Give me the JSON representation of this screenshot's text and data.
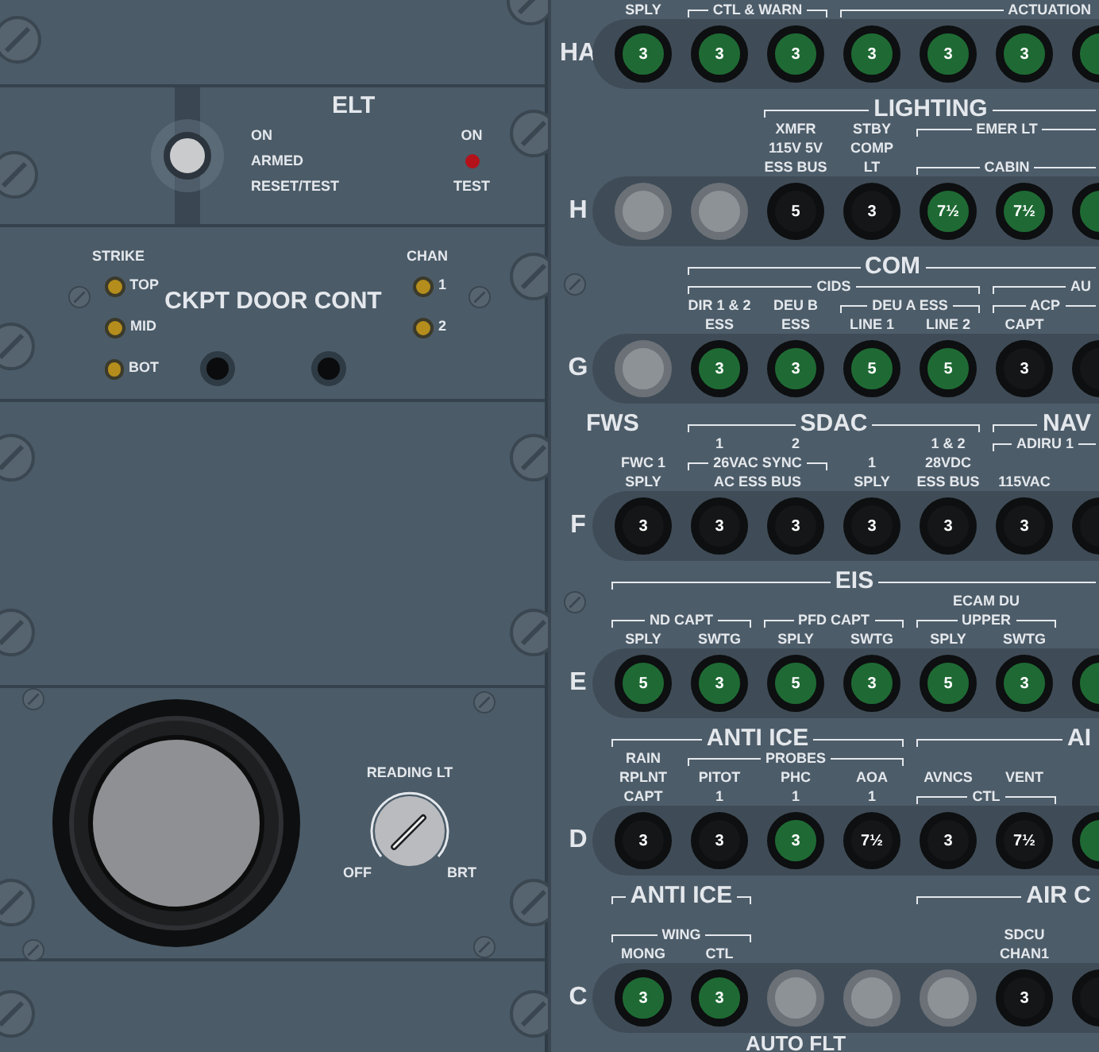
{
  "elt": {
    "title": "ELT",
    "positions": [
      {
        "label": "ON",
        "selected": false
      },
      {
        "label": "ARMED",
        "selected": true
      },
      {
        "label": "RESET/TEST",
        "selected": false
      }
    ],
    "indicator": {
      "top": "ON",
      "bottom": "TEST"
    }
  },
  "ckpt_door": {
    "title": "CKPT DOOR CONT",
    "strike_label": "STRIKE",
    "strike_lights": [
      "TOP",
      "MID",
      "BOT"
    ],
    "chan_label": "CHAN",
    "chan_lights": [
      "1",
      "2"
    ]
  },
  "reading_lt": {
    "title": "READING LT",
    "min": "OFF",
    "max": "BRT"
  },
  "rows": [
    {
      "label": "HA",
      "header": [
        {
          "kind": "label",
          "text": "SPLY"
        },
        {
          "kind": "group",
          "text": "CTL & WARN"
        },
        {
          "kind": "group",
          "text": "ACTUATION"
        }
      ],
      "breakers": [
        {
          "kind": "green",
          "value": "3"
        },
        {
          "kind": "green",
          "value": "3"
        },
        {
          "kind": "green",
          "value": "3"
        },
        {
          "kind": "green",
          "value": "3"
        },
        {
          "kind": "green",
          "value": "3"
        },
        {
          "kind": "green",
          "value": "3"
        },
        {
          "kind": "green"
        }
      ]
    },
    {
      "label": "H",
      "header": [
        {
          "kind": "title",
          "text": "LIGHTING"
        },
        {
          "kind": "label",
          "text": "XMFR\n115V 5V\nESS BUS"
        },
        {
          "kind": "label",
          "text": "STBY\nCOMP\nLT"
        },
        {
          "kind": "group",
          "text": "EMER LT"
        },
        {
          "kind": "group",
          "text": "CABIN"
        }
      ],
      "breakers": [
        {
          "kind": "blank"
        },
        {
          "kind": "blank"
        },
        {
          "kind": "black",
          "value": "5"
        },
        {
          "kind": "black",
          "value": "3"
        },
        {
          "kind": "green",
          "value": "7½"
        },
        {
          "kind": "green",
          "value": "7½"
        },
        {
          "kind": "green"
        }
      ]
    },
    {
      "label": "G",
      "header": [
        {
          "kind": "title",
          "text": "COM"
        },
        {
          "kind": "group",
          "text": "CIDS"
        },
        {
          "kind": "group",
          "text": "AU"
        },
        {
          "kind": "label",
          "text": "DIR 1 & 2\nESS"
        },
        {
          "kind": "label",
          "text": "DEU B\nESS"
        },
        {
          "kind": "group",
          "text": "DEU A ESS"
        },
        {
          "kind": "label",
          "text": "LINE 1"
        },
        {
          "kind": "label",
          "text": "LINE 2"
        },
        {
          "kind": "group",
          "text": "ACP"
        },
        {
          "kind": "label",
          "text": "CAPT"
        }
      ],
      "breakers": [
        {
          "kind": "blank"
        },
        {
          "kind": "green",
          "value": "3"
        },
        {
          "kind": "green",
          "value": "3"
        },
        {
          "kind": "green",
          "value": "5"
        },
        {
          "kind": "green",
          "value": "5"
        },
        {
          "kind": "black",
          "value": "3"
        },
        {
          "kind": "black"
        }
      ]
    },
    {
      "label": "F",
      "header": [
        {
          "kind": "heading",
          "text": "FWS"
        },
        {
          "kind": "title",
          "text": "SDAC"
        },
        {
          "kind": "title",
          "text": "NAV"
        },
        {
          "kind": "label",
          "text": "1"
        },
        {
          "kind": "label",
          "text": "2"
        },
        {
          "kind": "label",
          "text": "1 & 2\n28VDC\nESS BUS"
        },
        {
          "kind": "group",
          "text": "ADIRU 1"
        },
        {
          "kind": "label",
          "text": "FWC 1\nSPLY"
        },
        {
          "kind": "group",
          "text": "26VAC SYNC"
        },
        {
          "kind": "label",
          "text": "AC ESS BUS"
        },
        {
          "kind": "label",
          "text": "1\nSPLY"
        },
        {
          "kind": "label",
          "text": "115VAC"
        }
      ],
      "breakers": [
        {
          "kind": "black",
          "value": "3"
        },
        {
          "kind": "black",
          "value": "3"
        },
        {
          "kind": "black",
          "value": "3"
        },
        {
          "kind": "black",
          "value": "3"
        },
        {
          "kind": "black",
          "value": "3"
        },
        {
          "kind": "black",
          "value": "3"
        },
        {
          "kind": "black"
        }
      ]
    },
    {
      "label": "E",
      "header": [
        {
          "kind": "title",
          "text": "EIS"
        },
        {
          "kind": "label",
          "text": "ECAM DU"
        },
        {
          "kind": "group",
          "text": "ND  CAPT"
        },
        {
          "kind": "group",
          "text": "PFD  CAPT"
        },
        {
          "kind": "group",
          "text": "UPPER"
        },
        {
          "kind": "label",
          "text": "SPLY"
        },
        {
          "kind": "label",
          "text": "SWTG"
        },
        {
          "kind": "label",
          "text": "SPLY"
        },
        {
          "kind": "label",
          "text": "SWTG"
        },
        {
          "kind": "label",
          "text": "SPLY"
        },
        {
          "kind": "label",
          "text": "SWTG"
        }
      ],
      "breakers": [
        {
          "kind": "green",
          "value": "5"
        },
        {
          "kind": "green",
          "value": "3"
        },
        {
          "kind": "green",
          "value": "5"
        },
        {
          "kind": "green",
          "value": "3"
        },
        {
          "kind": "green",
          "value": "5"
        },
        {
          "kind": "green",
          "value": "3"
        },
        {
          "kind": "green"
        }
      ]
    },
    {
      "label": "D",
      "header": [
        {
          "kind": "title",
          "text": "ANTI ICE"
        },
        {
          "kind": "title",
          "text": "AI"
        },
        {
          "kind": "label",
          "text": "RAIN\nRPLNT\nCAPT"
        },
        {
          "kind": "group",
          "text": "PROBES"
        },
        {
          "kind": "label",
          "text": "PITOT\n1"
        },
        {
          "kind": "label",
          "text": "PHC\n1"
        },
        {
          "kind": "label",
          "text": "AOA\n1"
        },
        {
          "kind": "label",
          "text": "AVNCS"
        },
        {
          "kind": "label",
          "text": "VENT"
        },
        {
          "kind": "group",
          "text": "CTL"
        }
      ],
      "breakers": [
        {
          "kind": "black",
          "value": "3"
        },
        {
          "kind": "black",
          "value": "3"
        },
        {
          "kind": "green",
          "value": "3"
        },
        {
          "kind": "black",
          "value": "7½"
        },
        {
          "kind": "black",
          "value": "3"
        },
        {
          "kind": "black",
          "value": "7½"
        },
        {
          "kind": "green"
        }
      ]
    },
    {
      "label": "C",
      "header": [
        {
          "kind": "title",
          "text": "ANTI ICE"
        },
        {
          "kind": "title",
          "text": "AIR C"
        },
        {
          "kind": "group",
          "text": "WING"
        },
        {
          "kind": "label",
          "text": "MONG"
        },
        {
          "kind": "label",
          "text": "CTL"
        },
        {
          "kind": "label",
          "text": "SDCU\nCHAN1"
        }
      ],
      "breakers": [
        {
          "kind": "green",
          "value": "3"
        },
        {
          "kind": "green",
          "value": "3"
        },
        {
          "kind": "blank"
        },
        {
          "kind": "blank"
        },
        {
          "kind": "blank"
        },
        {
          "kind": "black",
          "value": "3"
        },
        {
          "kind": "black"
        }
      ]
    }
  ],
  "footer_title": "AUTO FLT"
}
